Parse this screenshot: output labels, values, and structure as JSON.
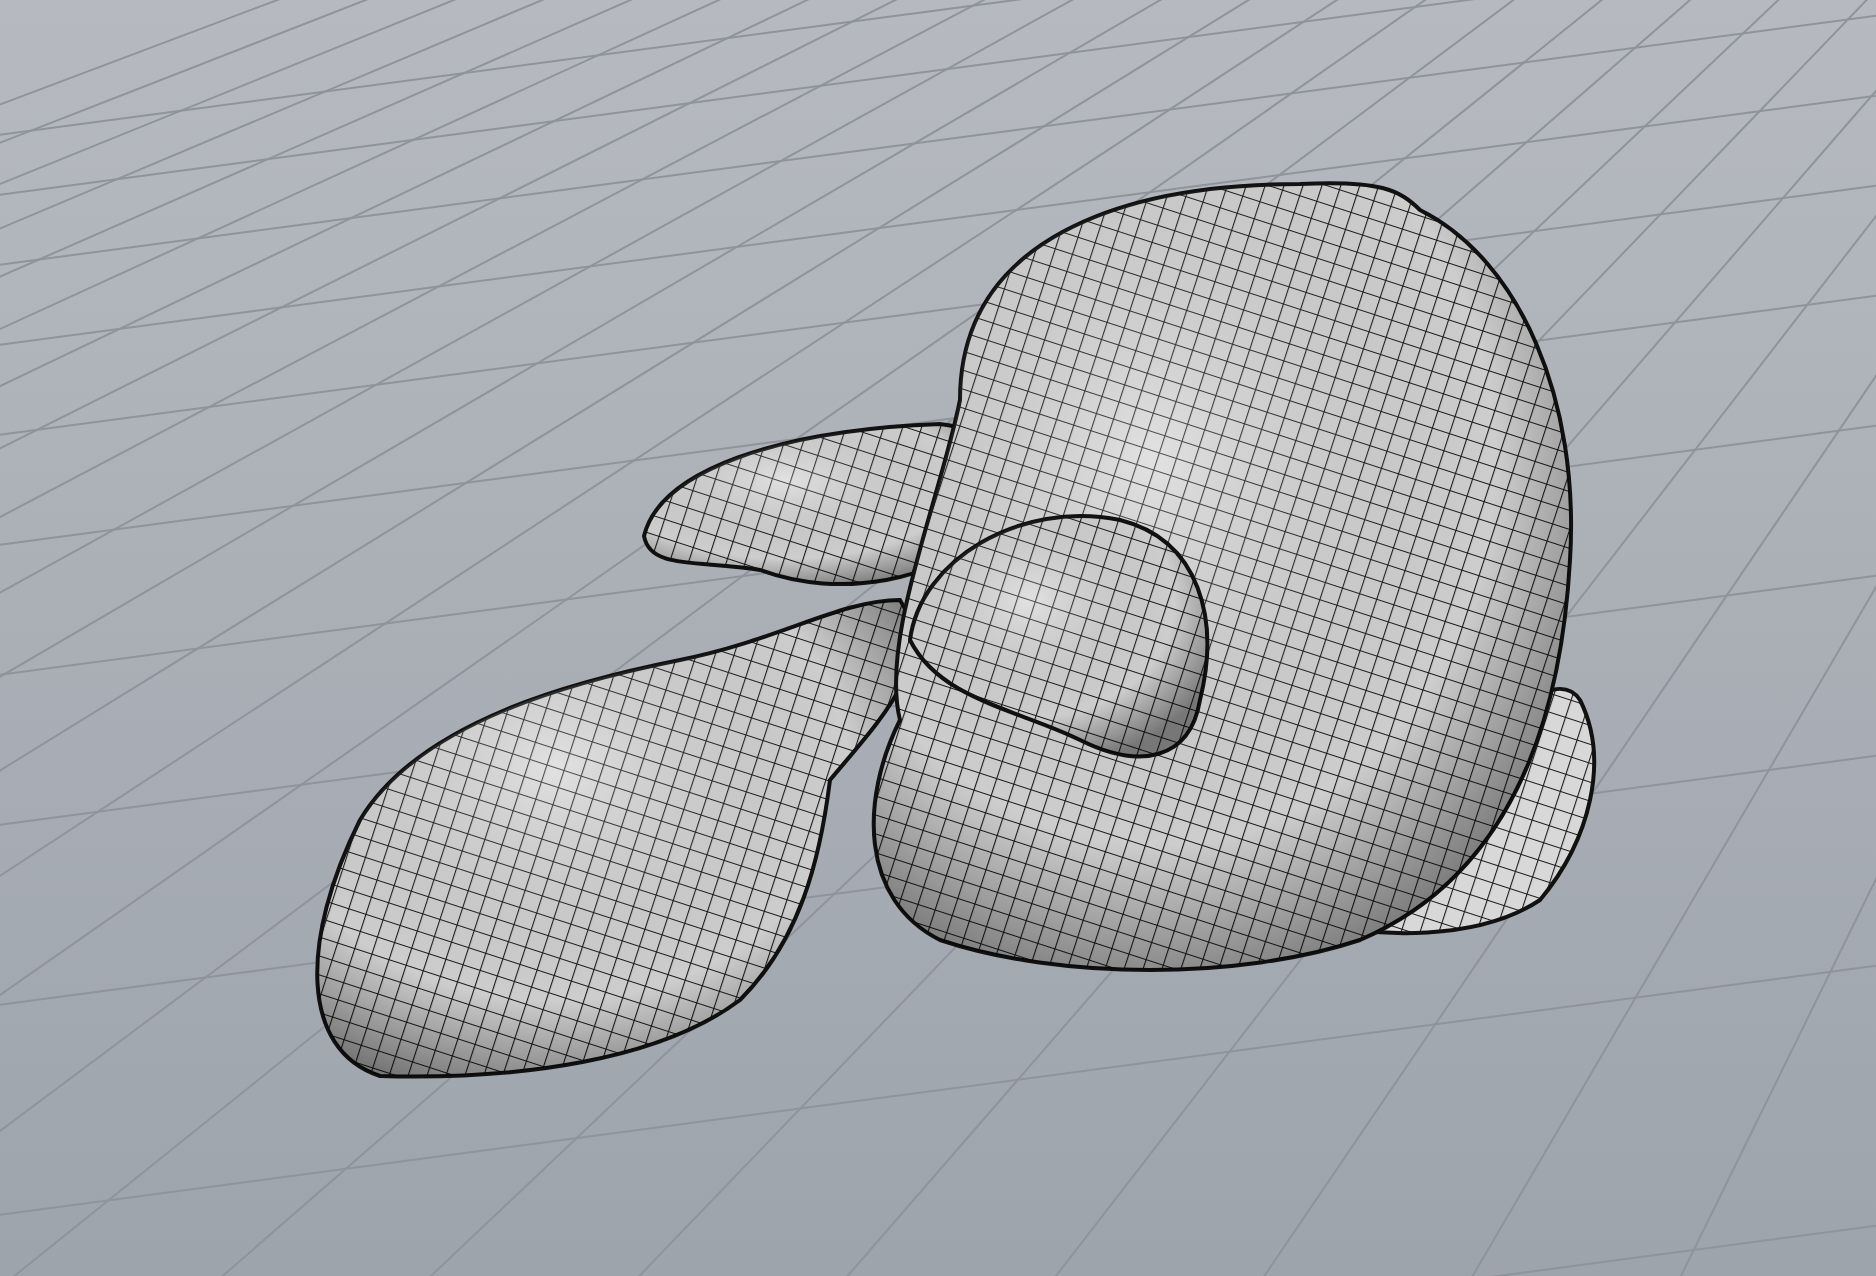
{
  "viewport": {
    "grid": true,
    "mesh_wireframe": true
  }
}
